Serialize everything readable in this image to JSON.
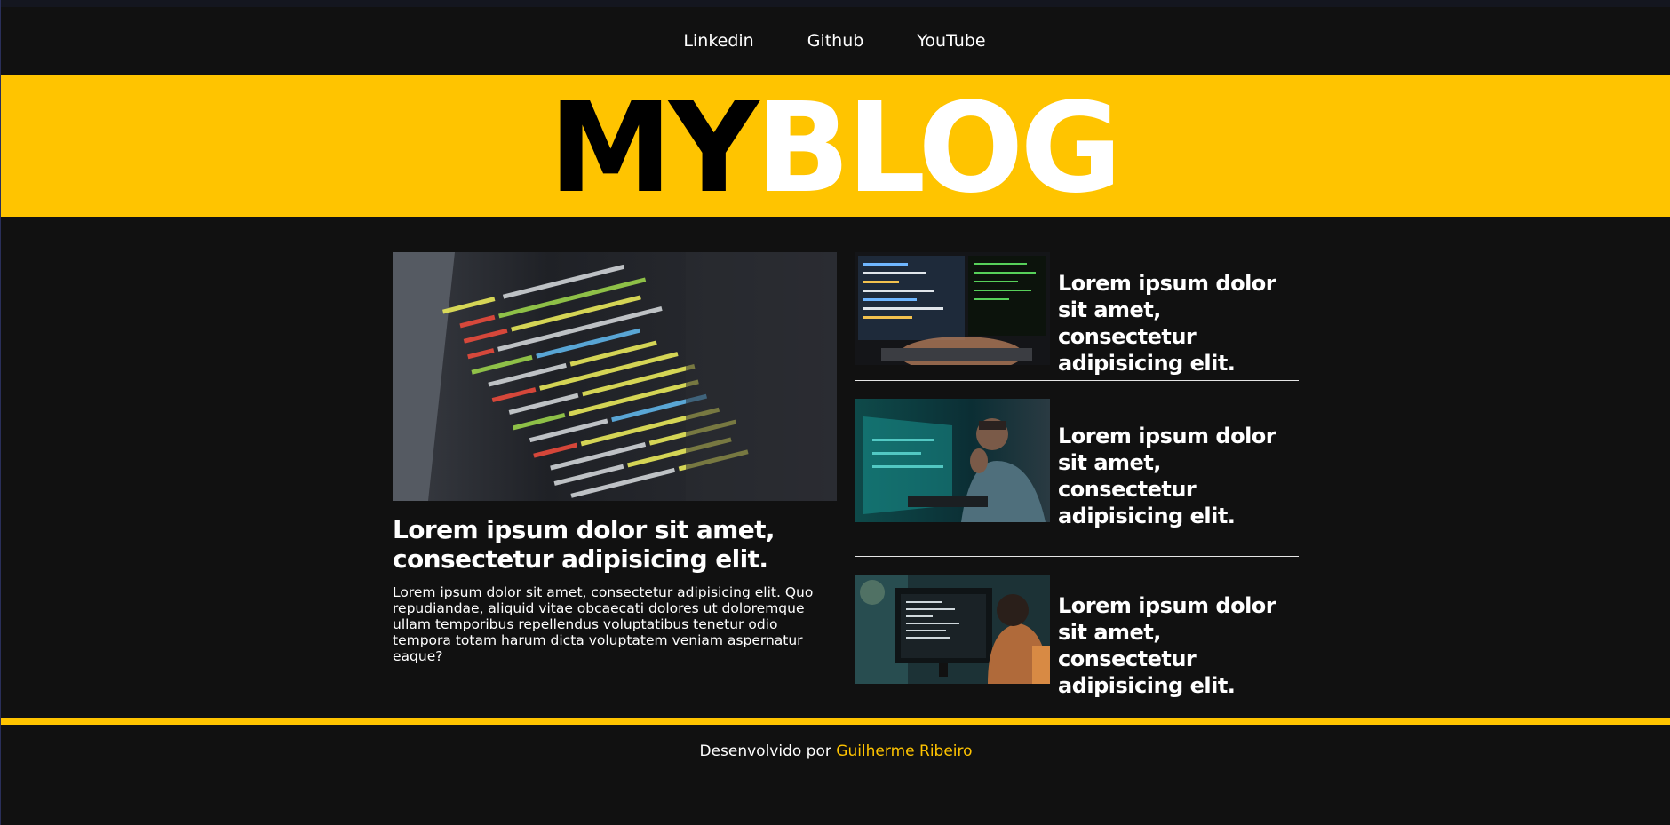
{
  "nav": {
    "links": [
      "Linkedin",
      "Github",
      "YouTube"
    ]
  },
  "hero": {
    "logo_dark": "MY",
    "logo_light": "BLOG"
  },
  "featured": {
    "title": "Lorem ipsum dolor sit amet, consectetur adipisicing elit.",
    "body": "Lorem ipsum dolor sit amet, consectetur adipisicing elit. Quo repudiandae, aliquid vitae obcaecati dolores ut doloremque ullam temporibus repellendus voluptatibus tenetur odio tempora totam harum dicta voluptatem veniam aspernatur eaque?"
  },
  "side_posts": [
    {
      "title": "Lorem ipsum dolor sit amet, consectetur adipisicing elit."
    },
    {
      "title": "Lorem ipsum dolor sit amet, consectetur adipisicing elit."
    },
    {
      "title": "Lorem ipsum dolor sit amet, consectetur adipisicing elit."
    }
  ],
  "footer": {
    "prefix": "Desenvolvido por ",
    "author": "Guilherme Ribeiro"
  },
  "colors": {
    "accent": "#ffc400",
    "background": "#111111",
    "text": "#ffffff"
  }
}
